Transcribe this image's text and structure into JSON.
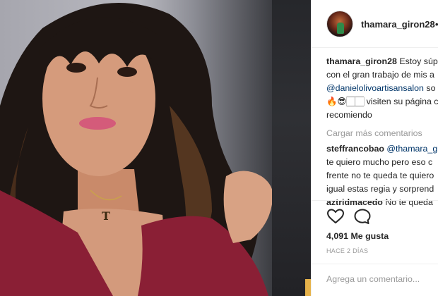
{
  "post": {
    "author": "thamara_giron28",
    "dot": "•"
  },
  "comments": {
    "caption": {
      "user": "thamara_giron28",
      "line1": "Estoy súp",
      "line2": "con el gran trabajo de mis a",
      "mention": "@danielolivoartisansalon",
      "mention_tail": " so",
      "line4": "🔥😎🏻🏻 visiten su página ch",
      "line5": "recomiendo"
    },
    "load_more": "Cargar más comentarios",
    "c1": {
      "user": "steffrancobao",
      "mention": "@thamara_g",
      "line2": "te quiero mucho pero eso c",
      "line3": "frente no te queda te quiero",
      "line4": "igual estas regia y sorprend"
    },
    "c2": {
      "user": "aztridmacedo",
      "text": "No te queda"
    }
  },
  "actions": {
    "like_icon": "heart-icon",
    "comment_icon": "comment-bubble-icon"
  },
  "likes": "4,091 Me gusta",
  "time": "HACE 2 DÍAS",
  "add_comment_placeholder": "Agrega un comentario...",
  "colors": {
    "mention": "#003569",
    "muted": "#999999",
    "text": "#262626",
    "dress": "#8a1f35"
  },
  "photo": {
    "necklace_letter": "T"
  }
}
